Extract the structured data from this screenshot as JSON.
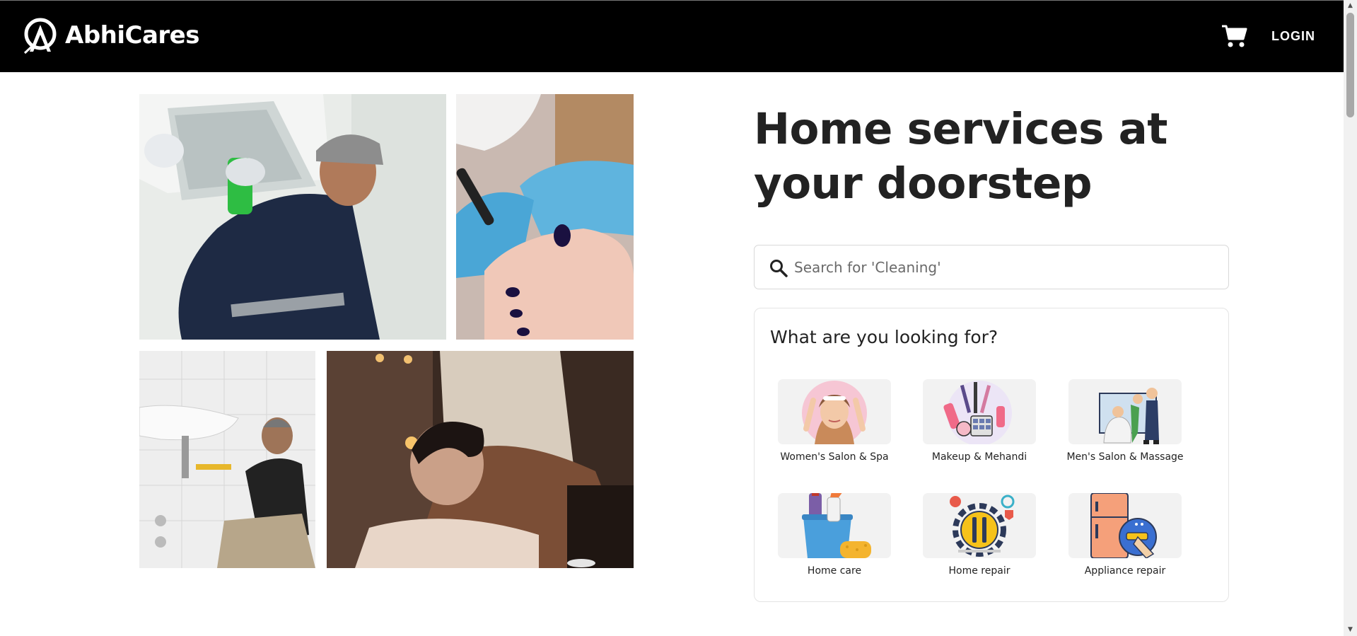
{
  "navbar": {
    "brand_name": "AbhiCares",
    "login_label": "LOGIN"
  },
  "hero": {
    "title_line1": "Home services at",
    "title_line2": "your doorstep"
  },
  "search": {
    "placeholder": "Search for 'Cleaning'"
  },
  "services": {
    "heading": "What are you looking for?",
    "items": [
      {
        "label": "Women's Salon & Spa",
        "icon": "woman-face-icon"
      },
      {
        "label": "Makeup & Mehandi",
        "icon": "makeup-kit-icon"
      },
      {
        "label": "Men's Salon & Massage",
        "icon": "barber-icon"
      },
      {
        "label": "Home care",
        "icon": "cleaning-supplies-icon"
      },
      {
        "label": "Home repair",
        "icon": "repair-gear-icon"
      },
      {
        "label": "Appliance repair",
        "icon": "fridge-repair-icon"
      }
    ]
  },
  "colors": {
    "navbar_bg": "#000000",
    "title_text": "#222222",
    "tile_bg": "#f2f2f2"
  }
}
